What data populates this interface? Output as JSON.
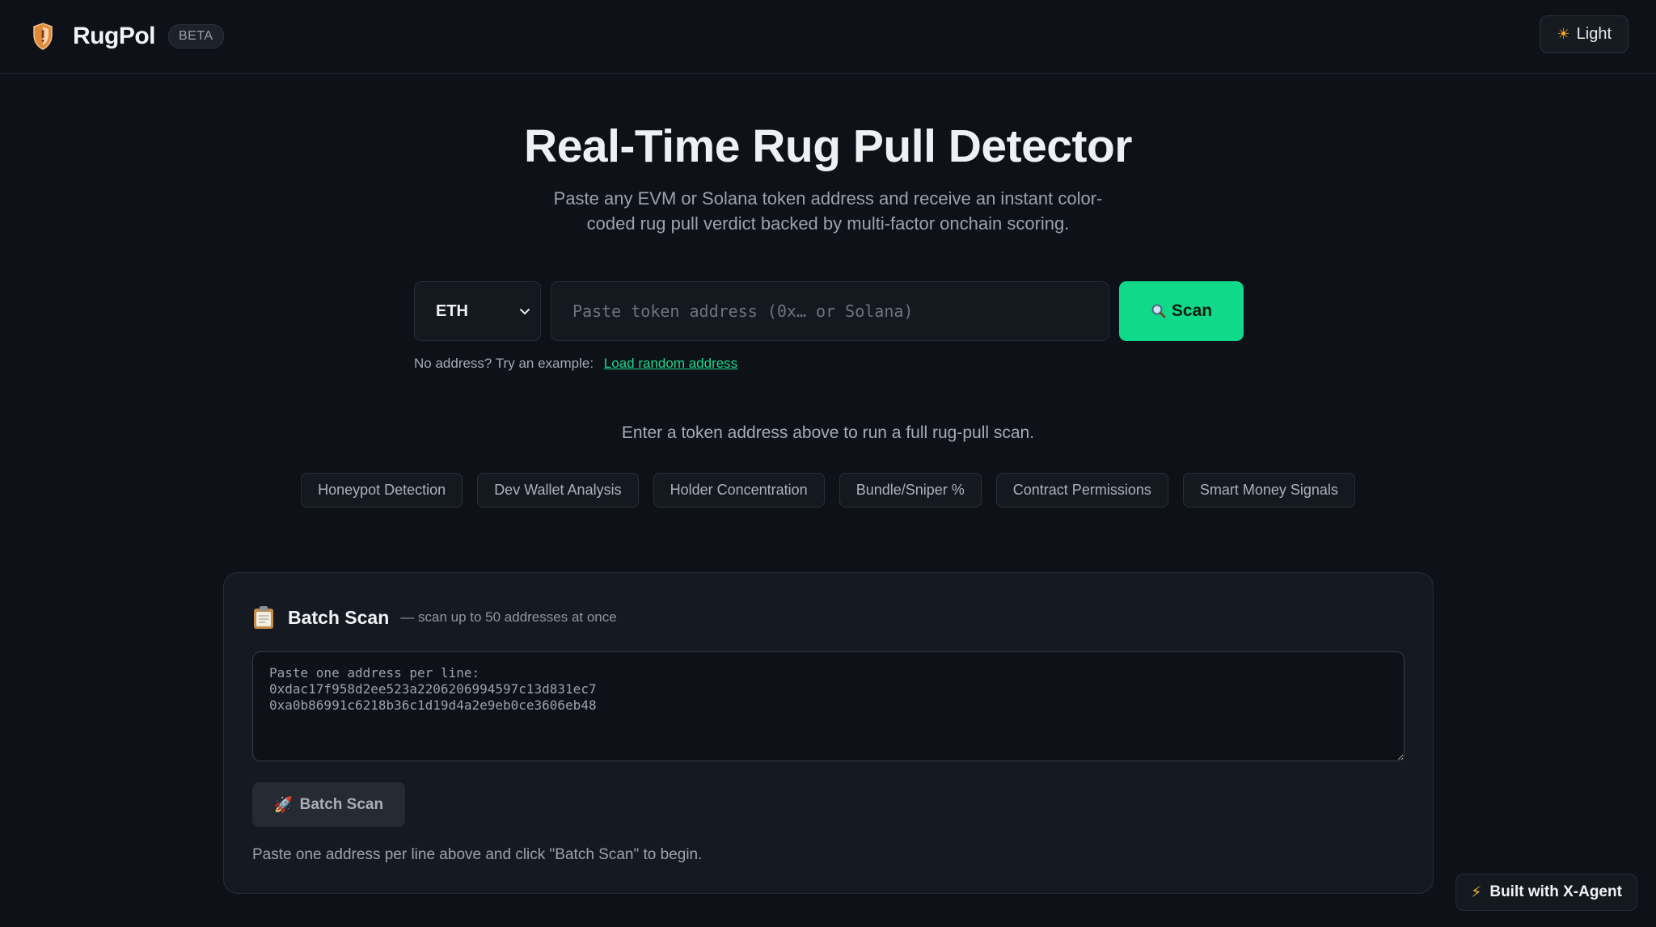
{
  "header": {
    "brand": "RugPol",
    "badge": "BETA",
    "theme_toggle": "Light",
    "theme_icon": "sun-icon"
  },
  "hero": {
    "title": "Real-Time Rug Pull Detector",
    "subtitle": "Paste any EVM or Solana token address and receive an instant color-coded rug pull verdict backed by multi-factor onchain scoring."
  },
  "search": {
    "chain_selected": "ETH",
    "placeholder": "Paste token address (0x… or Solana)",
    "scan_label": "Scan",
    "example_prefix": "No address? Try an example:",
    "example_link": "Load random address"
  },
  "hint": "Enter a token address above to run a full rug-pull scan.",
  "features": [
    "Honeypot Detection",
    "Dev Wallet Analysis",
    "Holder Concentration",
    "Bundle/Sniper %",
    "Contract Permissions",
    "Smart Money Signals"
  ],
  "batch": {
    "title": "Batch Scan",
    "subtitle": "— scan up to 50 addresses at once",
    "placeholder": "Paste one address per line:\n0xdac17f958d2ee523a2206206994597c13d831ec7\n0xa0b86991c6218b36c1d19d4a2e9eb0ce3606eb48",
    "button_label": "Batch Scan",
    "footer": "Paste one address per line above and click \"Batch Scan\" to begin."
  },
  "footer_badge": "Built with X-Agent",
  "colors": {
    "accent": "#10d98a",
    "background": "#0e1117",
    "card": "#151a22"
  }
}
